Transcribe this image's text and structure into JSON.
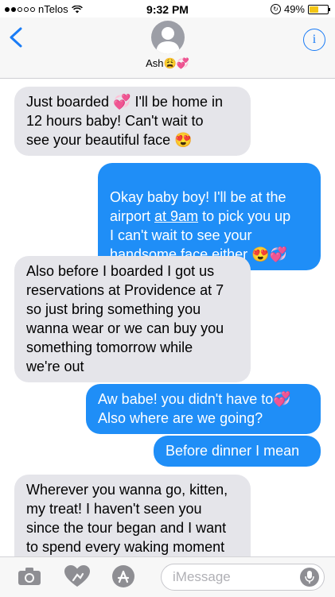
{
  "status_bar": {
    "signal_bars_filled": 2,
    "signal_bars_total": 5,
    "carrier": "nTelos",
    "time": "9:32 PM",
    "battery": "49%",
    "battery_level": 0.49
  },
  "header": {
    "contact_name": "Ash😩💞",
    "back_icon": "chevron-left-icon",
    "info_icon": "info-icon",
    "info_glyph": "i"
  },
  "messages": [
    {
      "side": "in",
      "text": "Just boarded 💞 I'll be home in\n12 hours baby! Can't wait to\nsee your beautiful face 😍"
    },
    {
      "side": "out",
      "text_before": "Okay baby boy! I'll be at the\nairport ",
      "link": "at 9am",
      "text_after": " to pick you up\nI can't wait to see your\nhandsome face either 😍💞"
    },
    {
      "side": "in",
      "text": "Also before I boarded I got us\nreservations at Providence at 7\nso just bring something you\nwanna wear or we can buy you\nsomething tomorrow while\nwe're out"
    },
    {
      "side": "out",
      "text": "Aw babe! you didn't have to💞\nAlso where are we going?"
    },
    {
      "side": "out",
      "text": "Before dinner I mean"
    },
    {
      "side": "in",
      "text": "Wherever you wanna go, kitten,\nmy treat! I haven't seen you\nsince the tour began and I want\nto spend every waking moment\nwith you, ashley ❤️"
    }
  ],
  "input_bar": {
    "placeholder": "iMessage",
    "icons": [
      "camera-icon",
      "digital-touch-icon",
      "app-store-icon",
      "microphone-icon"
    ]
  }
}
